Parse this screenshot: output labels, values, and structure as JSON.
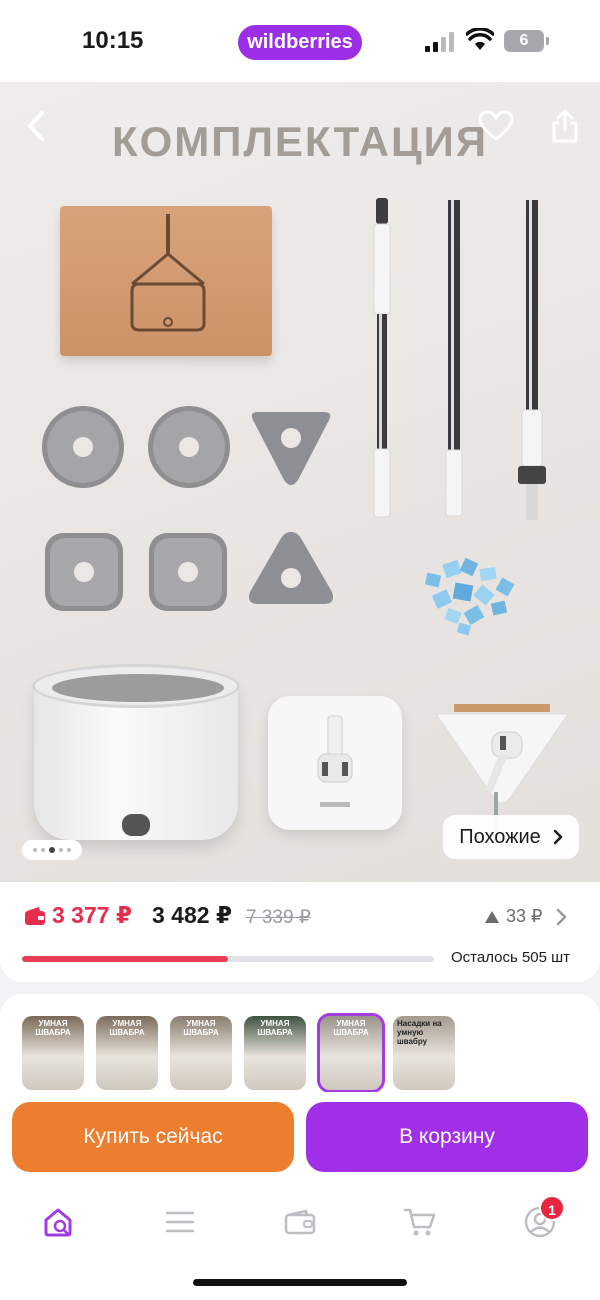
{
  "status": {
    "time": "10:15",
    "brand": "wildberries",
    "battery": "6"
  },
  "hero": {
    "title": "КОМПЛЕКТАЦИЯ",
    "similar_label": "Похожие",
    "slide_count": 5,
    "active_slide": 2
  },
  "price": {
    "wallet_price": "3 377 ₽",
    "main_price": "3 482 ₽",
    "old_price": "7 339 ₽",
    "trend": "33 ₽",
    "stock_text": "Осталось 505 шт",
    "stock_fraction": 0.5,
    "wallet_color": "#e62d4e"
  },
  "thumbnails": [
    {
      "text": "УМНАЯ ШВАБРА",
      "color": "#7b6a59"
    },
    {
      "text": "УМНАЯ ШВАБРА",
      "color": "#7c6c5d"
    },
    {
      "text": "УМНАЯ ШВАБРА",
      "color": "#8a7c6f"
    },
    {
      "text": "УМНАЯ ШВАБРА",
      "color": "#3f5240"
    },
    {
      "text": "УМНАЯ ШВАБРА",
      "color": "#9b938b"
    },
    {
      "text": "Насадки на умную швабру",
      "color": "#a59a8f"
    }
  ],
  "actions": {
    "buy_now": "Купить сейчас",
    "add_to_cart": "В корзину",
    "buy_color": "#ee7e2f",
    "cart_color": "#a12fe8"
  },
  "tabs": {
    "cart_badge": "1",
    "accent": "#a23be2"
  }
}
